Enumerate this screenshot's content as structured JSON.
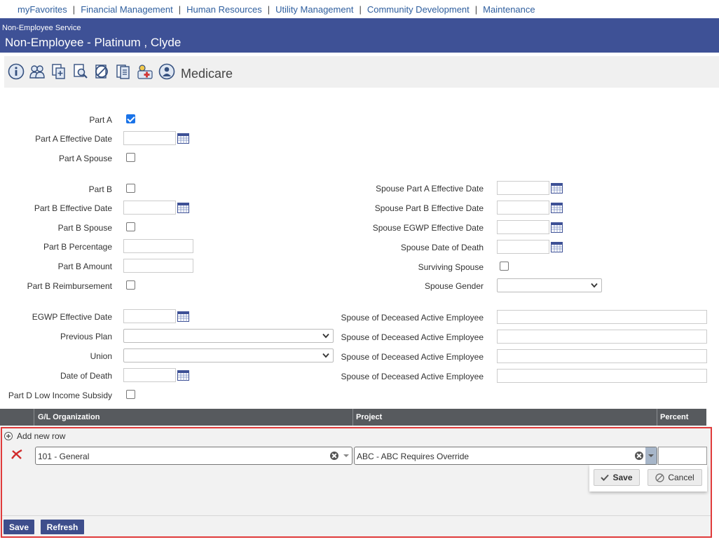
{
  "nav": {
    "items": [
      "myFavorites",
      "Financial Management",
      "Human Resources",
      "Utility Management",
      "Community Development",
      "Maintenance"
    ]
  },
  "header": {
    "subtitle": "Non-Employee Service",
    "title": "Non-Employee - Platinum , Clyde"
  },
  "toolbar": {
    "title": "Medicare",
    "icons": [
      "info-icon",
      "people-icon",
      "copy-icon",
      "document-search-icon",
      "cancel-icon",
      "documents-icon",
      "medical-icon",
      "person-icon"
    ]
  },
  "form": {
    "part_a": {
      "label": "Part A",
      "checked": true
    },
    "part_a_effective_date": {
      "label": "Part A Effective Date",
      "value": ""
    },
    "part_a_spouse": {
      "label": "Part A Spouse",
      "checked": false
    },
    "part_b": {
      "label": "Part B",
      "checked": false
    },
    "part_b_effective_date": {
      "label": "Part B Effective Date",
      "value": ""
    },
    "part_b_spouse": {
      "label": "Part B Spouse",
      "checked": false
    },
    "part_b_percentage": {
      "label": "Part B Percentage",
      "value": ""
    },
    "part_b_amount": {
      "label": "Part B Amount",
      "value": ""
    },
    "part_b_reimbursement": {
      "label": "Part B Reimbursement",
      "checked": false
    },
    "egwp_effective_date": {
      "label": "EGWP Effective Date",
      "value": ""
    },
    "previous_plan": {
      "label": "Previous Plan",
      "value": ""
    },
    "union": {
      "label": "Union",
      "value": ""
    },
    "date_of_death": {
      "label": "Date of Death",
      "value": ""
    },
    "part_d_low_income_subsidy": {
      "label": "Part D Low Income Subsidy",
      "checked": false
    },
    "spouse_part_a_effective_date": {
      "label": "Spouse Part A Effective Date",
      "value": ""
    },
    "spouse_part_b_effective_date": {
      "label": "Spouse Part B Effective Date",
      "value": ""
    },
    "spouse_egwp_effective_date": {
      "label": "Spouse EGWP Effective Date",
      "value": ""
    },
    "spouse_date_of_death": {
      "label": "Spouse Date of Death",
      "value": ""
    },
    "surviving_spouse": {
      "label": "Surviving Spouse",
      "checked": false
    },
    "spouse_gender": {
      "label": "Spouse Gender",
      "value": ""
    },
    "spouse_of_deceased": [
      {
        "label": "Spouse of Deceased Active Employee",
        "value": ""
      },
      {
        "label": "Spouse of Deceased Active Employee",
        "value": ""
      },
      {
        "label": "Spouse of Deceased Active Employee",
        "value": ""
      },
      {
        "label": "Spouse of Deceased Active Employee",
        "value": ""
      }
    ]
  },
  "grid": {
    "columns": [
      "G/L Organization",
      "Project",
      "Percent"
    ],
    "add_row_label": "Add new row",
    "row": {
      "gl_organization": "101 - General",
      "project": "ABC - ABC Requires Override",
      "percent": ""
    },
    "save_label": "Save",
    "cancel_label": "Cancel"
  },
  "footer": {
    "save_label": "Save",
    "refresh_label": "Refresh"
  },
  "colors": {
    "header_bg": "#3e5196",
    "nav_link": "#2e5e9e",
    "grid_header_bg": "#575a5e",
    "highlight_border": "#e03b3b",
    "checkbox_checked": "#1a73e8"
  }
}
